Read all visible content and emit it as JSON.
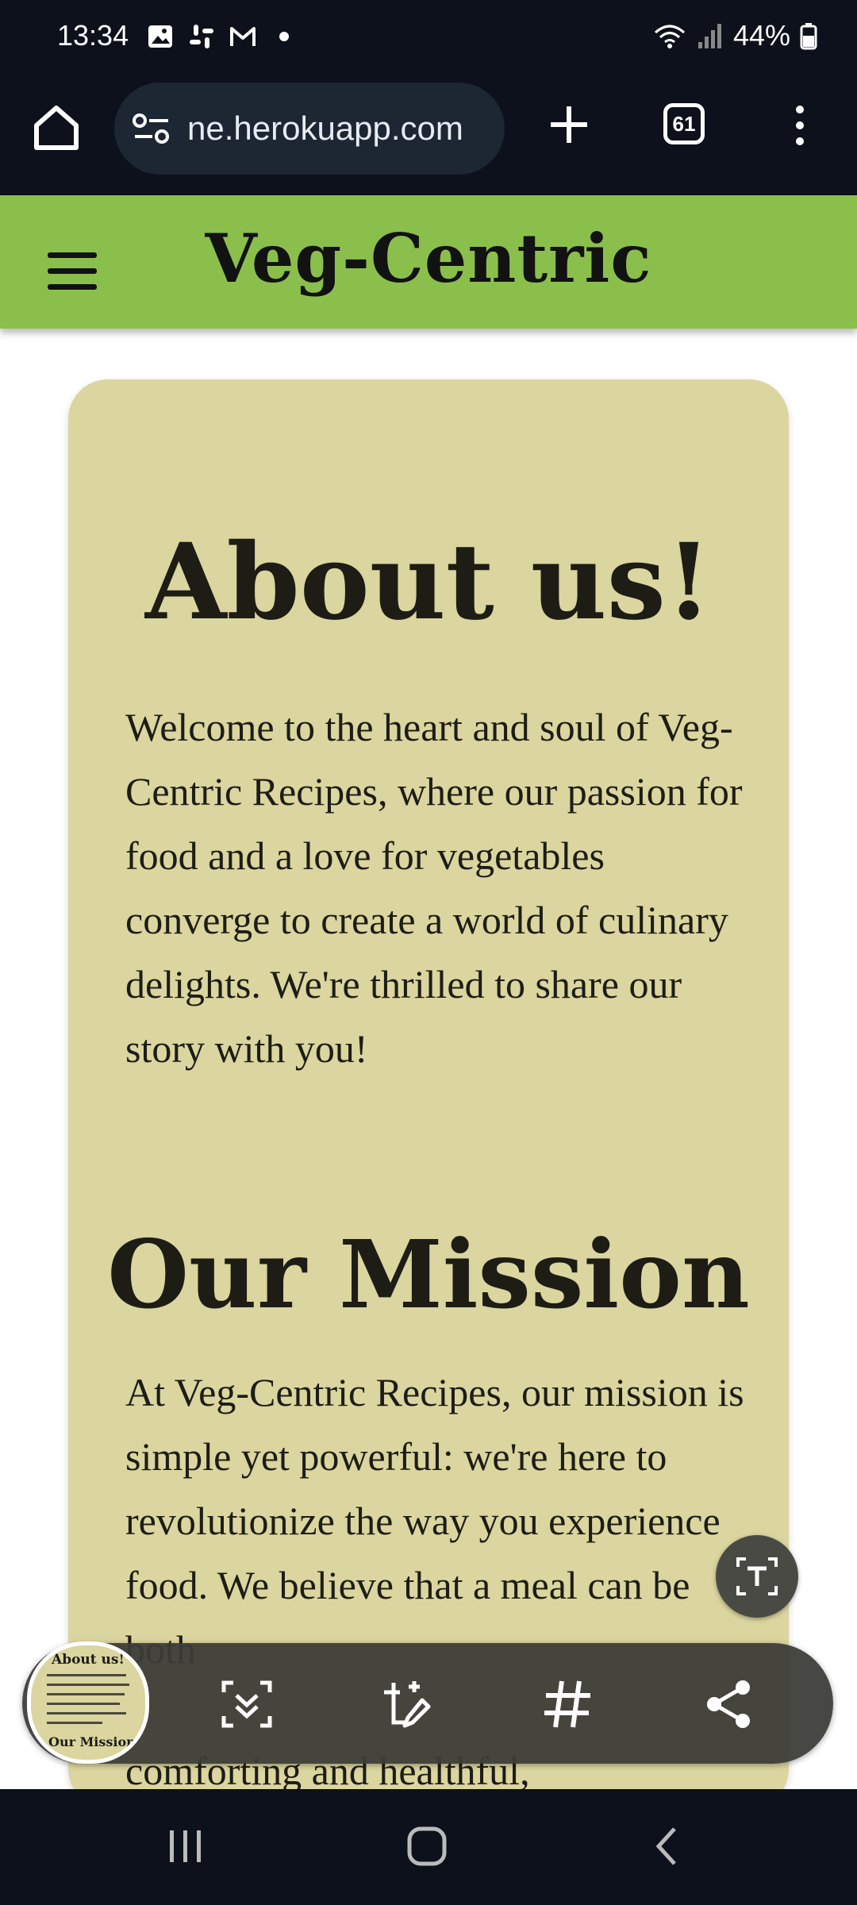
{
  "status_bar": {
    "time": "13:34",
    "battery": "44%",
    "left_icons": [
      "gallery-icon",
      "slack-icon",
      "gmail-icon",
      "dot-icon"
    ],
    "right_icons": [
      "wifi-icon",
      "signal-icon",
      "battery-icon"
    ]
  },
  "browser": {
    "url": "ne.herokuapp.com",
    "tab_count": "61"
  },
  "site": {
    "title": "Veg-Centric"
  },
  "about": {
    "heading": "About us!",
    "body": "Welcome to the heart and soul of Veg-Centric Recipes, where our passion for food and a love for vegetables converge to create a world of culinary delights. We're thrilled to share our story with you!"
  },
  "mission": {
    "heading": "Our Mission",
    "body": "At Veg-Centric Recipes, our mission is simple yet powerful: we're here to revolutionize the way you experience food. We believe that a meal can be both",
    "peek_line": "comforting and healthful,"
  },
  "screenshot_toolbar": {
    "thumb_title": "About us!",
    "thumb_subtitle": "Our Mission",
    "actions": [
      "scroll-capture-icon",
      "edit-crop-icon",
      "hashtag-icon",
      "share-icon"
    ]
  },
  "nav_bar": {
    "buttons": [
      "recents-icon",
      "home-icon",
      "back-icon"
    ]
  }
}
